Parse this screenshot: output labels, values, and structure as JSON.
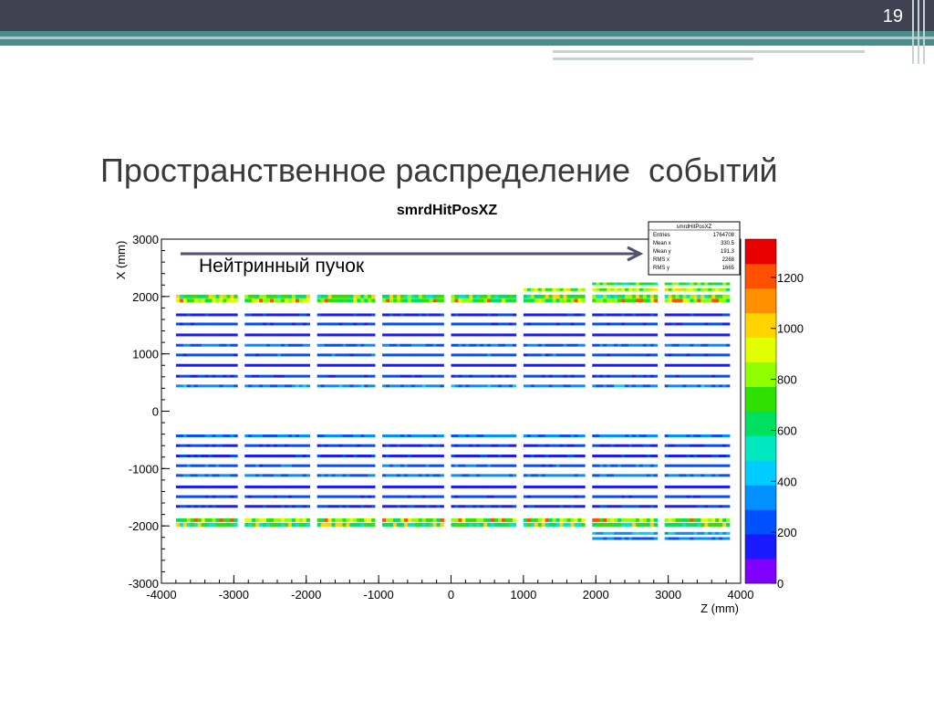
{
  "slide": {
    "number": "19",
    "title": "Пространственное распределение  событий",
    "annotation": "Нейтринный пучок"
  },
  "chart_data": {
    "type": "heatmap",
    "title": "smrdHitPosXZ",
    "xlabel": "Z (mm)",
    "ylabel": "X (mm)",
    "xlim": [
      -4000,
      4000
    ],
    "ylim": [
      -3000,
      3000
    ],
    "x_ticks": [
      -4000,
      -3000,
      -2000,
      -1000,
      0,
      1000,
      2000,
      3000,
      4000
    ],
    "y_ticks": [
      -3000,
      -2000,
      -1000,
      0,
      1000,
      2000,
      3000
    ],
    "colorbar": {
      "min": 0,
      "max": 1350,
      "ticks": [
        0,
        200,
        400,
        600,
        800,
        1000,
        1200
      ]
    },
    "stats_box": {
      "title": "smrdHitPosXZ",
      "rows": [
        {
          "label": "Entries",
          "value": "1764708"
        },
        {
          "label": "Mean x",
          "value": "330.5"
        },
        {
          "label": "Mean y",
          "value": "191.3"
        },
        {
          "label": "RMS x",
          "value": "2268"
        },
        {
          "label": "RMS y",
          "value": "1665"
        }
      ]
    },
    "z_segments": [
      [
        -3800,
        -2950
      ],
      [
        -2850,
        -1950
      ],
      [
        -1850,
        -1050
      ],
      [
        -950,
        -100
      ],
      [
        0,
        900
      ],
      [
        1000,
        1850
      ],
      [
        1950,
        2850
      ],
      [
        2950,
        3850
      ]
    ],
    "rows": [
      {
        "x": 2000,
        "level": 700,
        "dense": true
      },
      {
        "x": 1930,
        "level": 800,
        "dense": true
      },
      {
        "x": 1680,
        "level": 170
      },
      {
        "x": 1520,
        "level": 230
      },
      {
        "x": 1330,
        "level": 130
      },
      {
        "x": 1150,
        "level": 300
      },
      {
        "x": 980,
        "level": 240
      },
      {
        "x": 800,
        "level": 140
      },
      {
        "x": 610,
        "level": 210
      },
      {
        "x": 440,
        "level": 320
      },
      {
        "x": -430,
        "level": 300
      },
      {
        "x": -600,
        "level": 210
      },
      {
        "x": -780,
        "level": 170
      },
      {
        "x": -950,
        "level": 250
      },
      {
        "x": -1120,
        "level": 300
      },
      {
        "x": -1320,
        "level": 130
      },
      {
        "x": -1490,
        "level": 230
      },
      {
        "x": -1660,
        "level": 180
      },
      {
        "x": -1900,
        "level": 820,
        "dense": true
      },
      {
        "x": -1980,
        "level": 650,
        "dense": true
      }
    ],
    "extra_rows": [
      {
        "x": 2220,
        "level": 700,
        "z_from": 1950,
        "z_to": 3850
      },
      {
        "x": 2120,
        "level": 820,
        "z_from": 1000,
        "z_to": 3850
      },
      {
        "x": -2130,
        "level": 400,
        "z_from": 1950,
        "z_to": 3850
      },
      {
        "x": -2220,
        "level": 300,
        "z_from": 1950,
        "z_to": 3850
      }
    ],
    "colors": [
      "#7f00ff",
      "#1a1aff",
      "#0050ff",
      "#0090ff",
      "#00ccff",
      "#00e8c0",
      "#00e060",
      "#30e000",
      "#90ff00",
      "#e0ff00",
      "#ffd400",
      "#ff9000",
      "#ff5000",
      "#e80000"
    ]
  }
}
